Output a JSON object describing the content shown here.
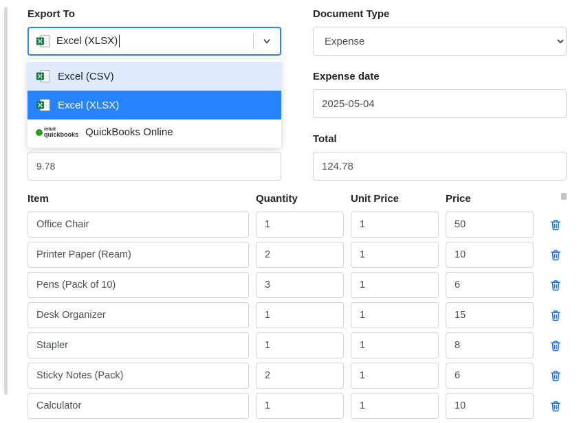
{
  "exportTo": {
    "label": "Export To",
    "value": "Excel (XLSX)",
    "options": [
      {
        "label": "Excel (CSV)",
        "icon": "excel"
      },
      {
        "label": "Excel (XLSX)",
        "icon": "excel"
      },
      {
        "label": "QuickBooks Online",
        "icon": "quickbooks"
      }
    ],
    "selectedIndex": 1,
    "hoveredIndex": 0
  },
  "documentType": {
    "label": "Document Type",
    "value": "Expense"
  },
  "expenseDate": {
    "label": "Expense date",
    "value": "2025-05-04"
  },
  "leftPeekValue": "9.78",
  "total": {
    "label": "Total",
    "value": "124.78"
  },
  "itemsTable": {
    "headers": {
      "item": "Item",
      "quantity": "Quantity",
      "unitPrice": "Unit Price",
      "price": "Price"
    },
    "rows": [
      {
        "item": "Office Chair",
        "quantity": "1",
        "unitPrice": "1",
        "price": "50"
      },
      {
        "item": "Printer Paper (Ream)",
        "quantity": "2",
        "unitPrice": "1",
        "price": "10"
      },
      {
        "item": "Pens (Pack of 10)",
        "quantity": "3",
        "unitPrice": "1",
        "price": "6"
      },
      {
        "item": "Desk Organizer",
        "quantity": "1",
        "unitPrice": "1",
        "price": "15"
      },
      {
        "item": "Stapler",
        "quantity": "1",
        "unitPrice": "1",
        "price": "8"
      },
      {
        "item": "Sticky Notes (Pack)",
        "quantity": "2",
        "unitPrice": "1",
        "price": "6"
      },
      {
        "item": "Calculator",
        "quantity": "1",
        "unitPrice": "1",
        "price": "10"
      }
    ]
  },
  "icons": {
    "qb_prefix": "intuit",
    "qb_word": "quickbooks"
  }
}
